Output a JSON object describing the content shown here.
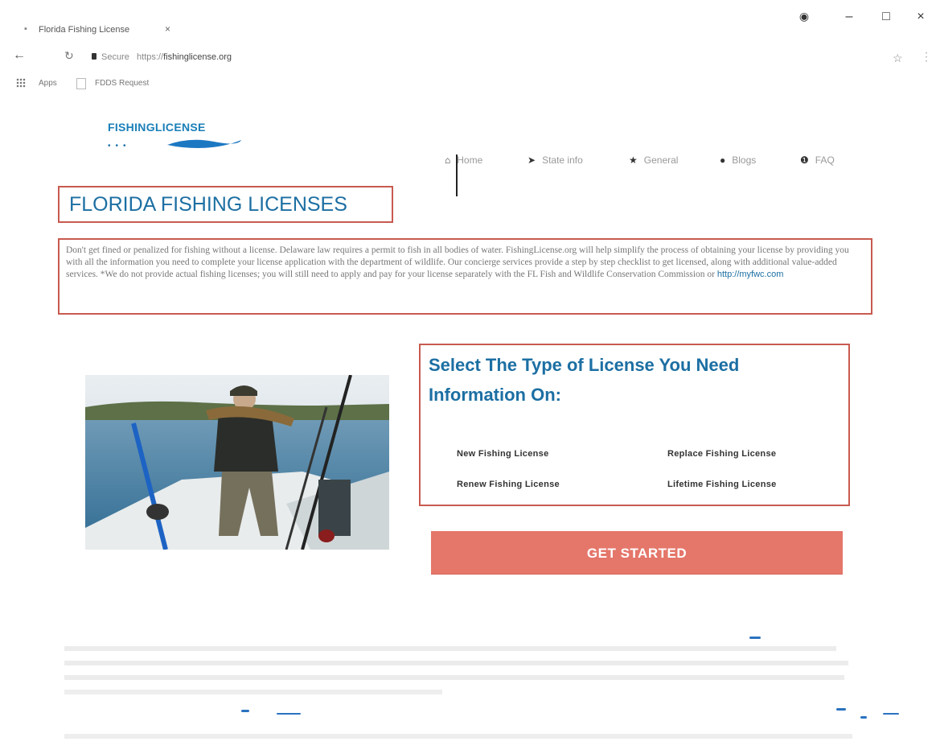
{
  "browser": {
    "tab_title": "Florida Fishing License",
    "tab_close": "×",
    "url_secure": "Secure",
    "url_scheme": "https://",
    "url_host": "fishinglicense.org",
    "bookmarks": [
      {
        "label": "Apps"
      },
      {
        "label": "FDDS Request"
      }
    ]
  },
  "site": {
    "logo_text": "FISHINGLICENSE",
    "nav": [
      {
        "label": "Home",
        "icon": "home-icon"
      },
      {
        "label": "State info",
        "icon": "location-arrow-icon"
      },
      {
        "label": "General",
        "icon": "star-icon"
      },
      {
        "label": "Blogs",
        "icon": "comment-icon"
      },
      {
        "label": "FAQ",
        "icon": "info-icon"
      }
    ]
  },
  "main": {
    "title": "FLORIDA FISHING LICENSES",
    "intro": "Don't get fined or penalized for fishing without a license. Delaware law requires a permit to fish in all bodies of water. FishingLicense.org will help simplify the process of obtaining your license by providing you with all the information you need to complete your license application with the department of wildlife. Our concierge services provide a step by step checklist to get licensed, along with additional value-added services. *We do not provide actual fishing licenses; you will still need to apply and pay for your license separately with the FL Fish and Wildlife Conservation Commission or",
    "intro_link": "http://myfwc.com",
    "select_heading": "Select The Type of License You Need Information On:",
    "license_options": [
      {
        "label": "New Fishing License"
      },
      {
        "label": "Replace Fishing License"
      },
      {
        "label": "Renew Fishing License"
      },
      {
        "label": "Lifetime Fishing License"
      }
    ],
    "cta_label": "GET STARTED"
  },
  "colors": {
    "accent_blue": "#1c6fa3",
    "highlight_border": "#c85a4f",
    "cta": "#e5766a"
  }
}
